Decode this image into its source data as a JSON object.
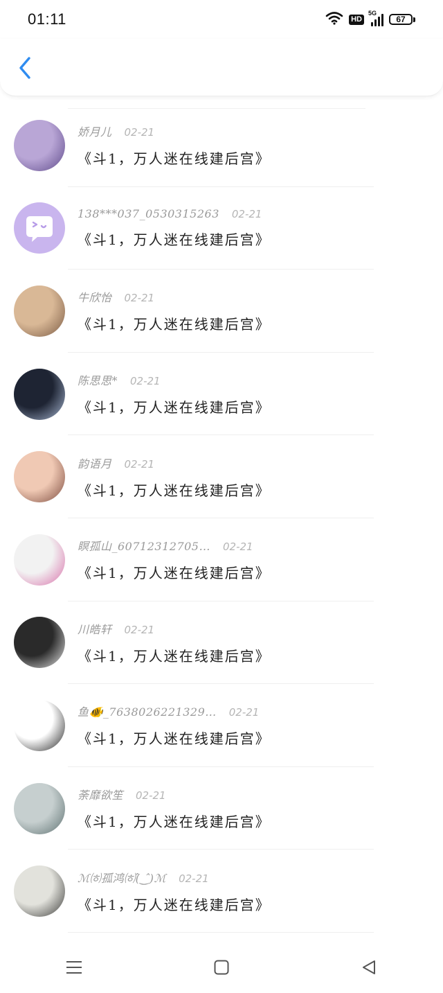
{
  "status_bar": {
    "time": "01:11",
    "network": "5G",
    "hd": "HD",
    "battery": "67"
  },
  "header": {
    "back_icon": "chevron-left-icon",
    "accent_color": "#2f8cf0"
  },
  "comments": [
    {
      "username": "娇月儿",
      "date": "02-21",
      "text": "《斗1，万人迷在线建后宫》",
      "avatar_colors": [
        "#b9a6d6",
        "#5e4a8a"
      ]
    },
    {
      "username": "138***037_0530315263",
      "date": "02-21",
      "text": "《斗1，万人迷在线建后宫》",
      "avatar_colors": [
        "#c9b5ee",
        "#ffffff"
      ]
    },
    {
      "username": "牛欣怡",
      "date": "02-21",
      "text": "《斗1，万人迷在线建后宫》",
      "avatar_colors": [
        "#d9b896",
        "#7a5a44"
      ]
    },
    {
      "username": "陈思思*",
      "date": "02-21",
      "text": "《斗1，万人迷在线建后宫》",
      "avatar_colors": [
        "#1e2433",
        "#a9b9d4"
      ]
    },
    {
      "username": "韵语月",
      "date": "02-21",
      "text": "《斗1，万人迷在线建后宫》",
      "avatar_colors": [
        "#f0c9b4",
        "#7b4a3e"
      ]
    },
    {
      "username": "瞑孤山_60712312705…",
      "date": "02-21",
      "text": "《斗1，万人迷在线建后宫》",
      "avatar_colors": [
        "#f2f2f2",
        "#d86fa9"
      ]
    },
    {
      "username": "川皓轩",
      "date": "02-21",
      "text": "《斗1，万人迷在线建后宫》",
      "avatar_colors": [
        "#2a2a2a",
        "#e8e8e8"
      ]
    },
    {
      "username": "鱼🐠_7638026221329…",
      "date": "02-21",
      "text": "《斗1，万人迷在线建后宫》",
      "avatar_colors": [
        "#ffffff",
        "#222222"
      ]
    },
    {
      "username": "荼靡欲笙",
      "date": "02-21",
      "text": "《斗1，万人迷在线建后宫》",
      "avatar_colors": [
        "#c6cfcf",
        "#5d7070"
      ]
    },
    {
      "username": "ℳ㈍孤鸿㈍(̂‿̂)ℳ",
      "date": "02-21",
      "text": "《斗1，万人迷在线建后宫》",
      "avatar_colors": [
        "#e2e2dc",
        "#3a3a38"
      ]
    }
  ],
  "nav_bar": {
    "menu_icon": "menu-icon",
    "home_icon": "home-square-icon",
    "back_icon": "back-triangle-icon"
  }
}
